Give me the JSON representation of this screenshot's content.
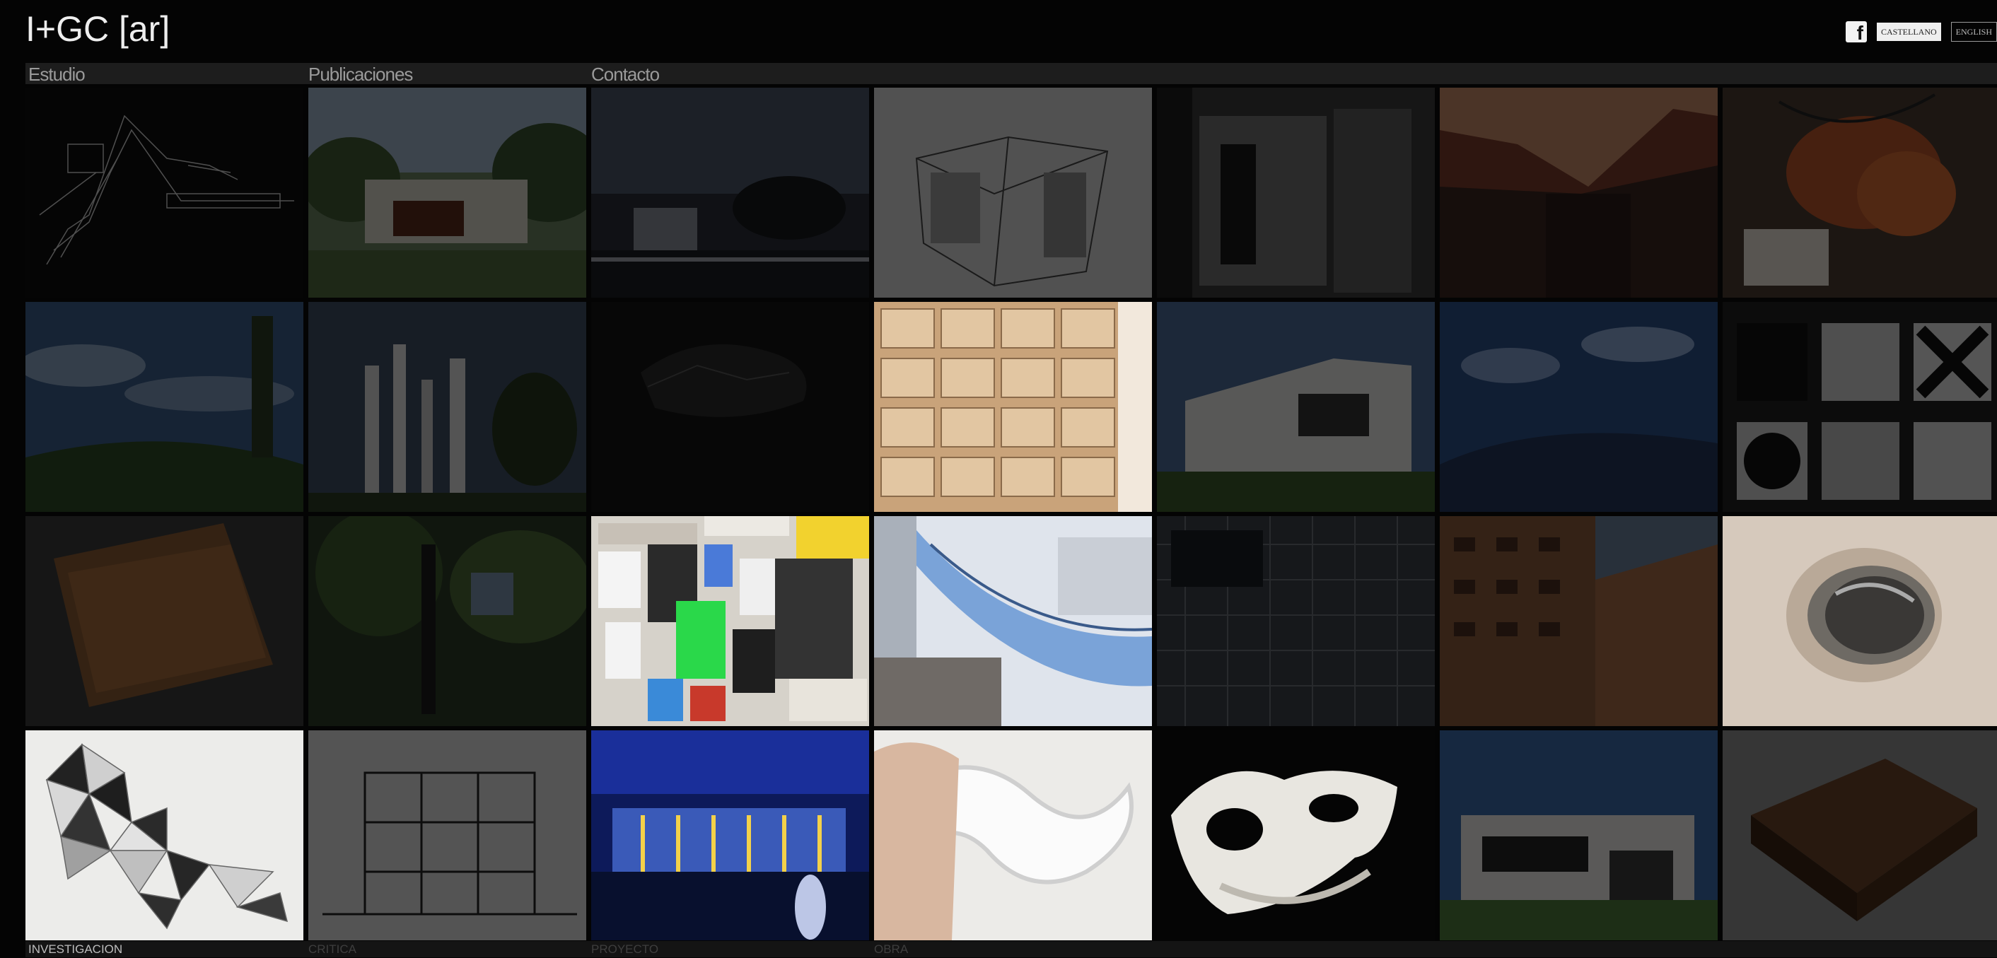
{
  "site": {
    "logo": "I+GC [ar]"
  },
  "header": {
    "languages": [
      "CASTELLANO",
      "ENGLISH"
    ]
  },
  "nav": {
    "items": [
      "Estudio",
      "Publicaciones",
      "Contacto"
    ]
  },
  "footer": {
    "categories": [
      "INVESTIGACION",
      "CRITICA",
      "PROYECTO",
      "OBRA"
    ]
  },
  "gallery": {
    "tiles": [
      "grid-diagram-thumbnail",
      "house-photo-thumbnail",
      "night-landscape-thumbnail",
      "model-sketch-thumbnail",
      "interior-photo-thumbnail",
      "red-sky-thumbnail",
      "orange-installation-thumbnail",
      "sky-hill-thumbnail",
      "tower-drawing-thumbnail",
      "dark-cloud-thumbnail",
      "cardboard-modules-thumbnail",
      "white-house-thumbnail",
      "blue-sky-thumbnail",
      "pattern-diagram-thumbnail",
      "brown-book-thumbnail",
      "trees-thumbnail",
      "corkboard-posters-thumbnail",
      "blue-canopy-thumbnail",
      "lattice-facade-thumbnail",
      "brick-building-thumbnail",
      "ceramic-tube-thumbnail",
      "triangle-panels-thumbnail",
      "elevation-drawing-thumbnail",
      "night-facade-thumbnail",
      "white-ribbon-thumbnail",
      "foam-sculpture-thumbnail",
      "modern-house-thumbnail",
      "wood-block-thumbnail"
    ]
  }
}
